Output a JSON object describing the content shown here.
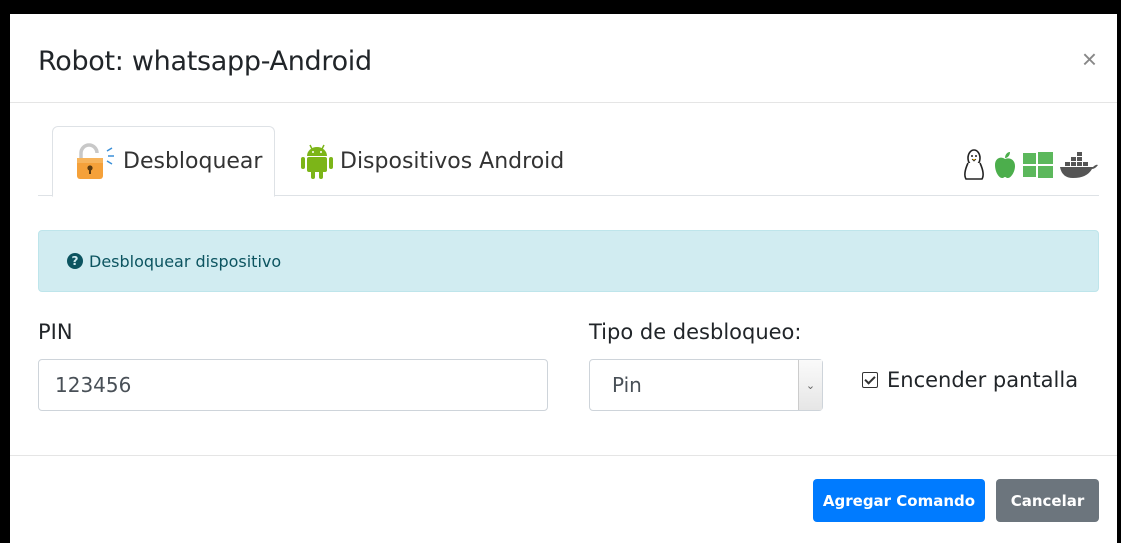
{
  "modal": {
    "title": "Robot: whatsapp-Android",
    "close_symbol": "×"
  },
  "tabs": [
    {
      "label": "Desbloquear",
      "icon": "unlock-icon",
      "active": true
    },
    {
      "label": "Dispositivos Android",
      "icon": "android-icon",
      "active": false
    }
  ],
  "os_icons": [
    "linux-icon",
    "apple-icon",
    "windows-icon",
    "docker-icon"
  ],
  "alert": {
    "icon": "question-circle-icon",
    "text": "Desbloquear dispositivo"
  },
  "form": {
    "pin_label": "PIN",
    "pin_value": "123456",
    "type_label": "Tipo de desbloqueo:",
    "type_value": "Pin",
    "screen_on_label": "Encender pantalla",
    "screen_on_checked": true
  },
  "footer": {
    "add_label": "Agregar Comando",
    "cancel_label": "Cancelar"
  },
  "colors": {
    "primary": "#007bff",
    "secondary": "#6c757d",
    "alert_bg": "#d1ecf1",
    "alert_text": "#0c5460",
    "android_green": "#3ddc84"
  }
}
